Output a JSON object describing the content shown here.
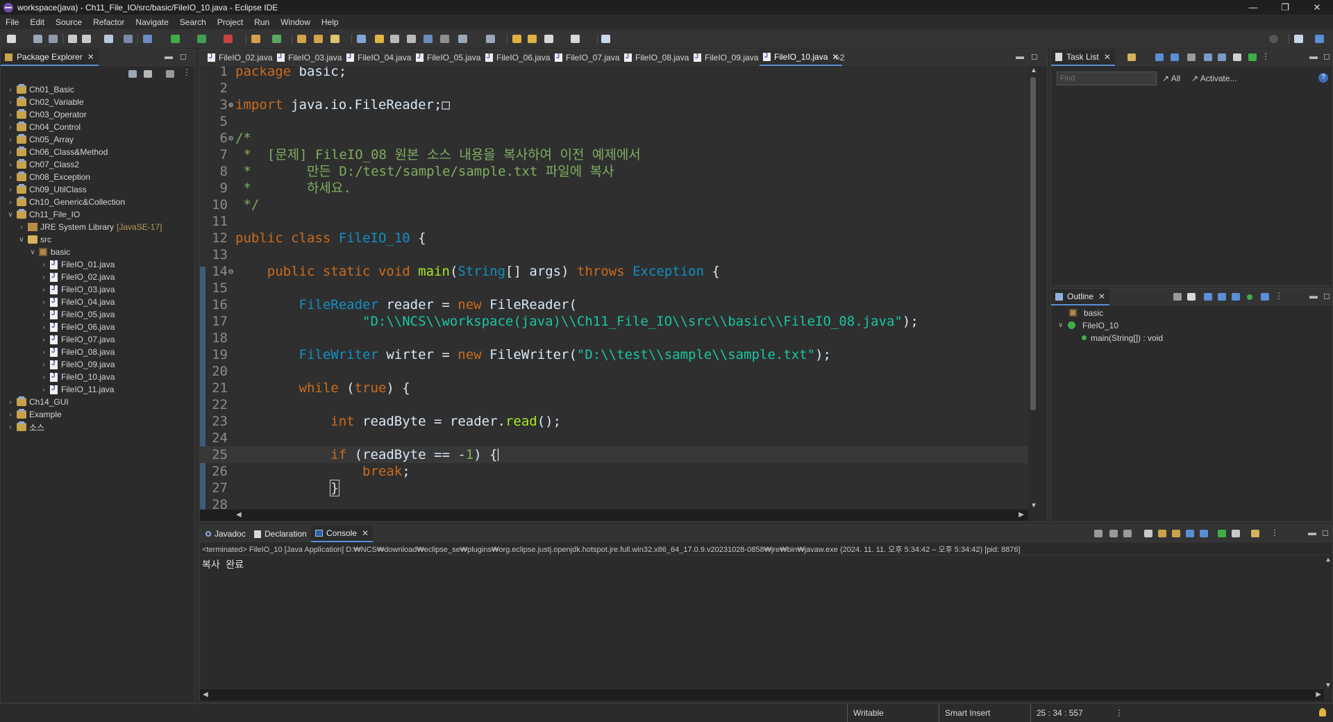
{
  "window": {
    "title": "workspace(java) - Ch11_File_IO/src/basic/FileIO_10.java - Eclipse IDE",
    "minimize": "—",
    "restore": "❐",
    "close": "✕"
  },
  "menu": [
    "File",
    "Edit",
    "Source",
    "Refactor",
    "Navigate",
    "Search",
    "Project",
    "Run",
    "Window",
    "Help"
  ],
  "package_explorer": {
    "title": "Package Explorer",
    "items": [
      {
        "label": "Ch01_Basic",
        "kind": "project",
        "level": 0,
        "expanded": false
      },
      {
        "label": "Ch02_Variable",
        "kind": "project",
        "level": 0,
        "expanded": false
      },
      {
        "label": "Ch03_Operator",
        "kind": "project",
        "level": 0,
        "expanded": false
      },
      {
        "label": "Ch04_Control",
        "kind": "project",
        "level": 0,
        "expanded": false
      },
      {
        "label": "Ch05_Array",
        "kind": "project",
        "level": 0,
        "expanded": false
      },
      {
        "label": "Ch06_Class&Method",
        "kind": "project",
        "level": 0,
        "expanded": false
      },
      {
        "label": "Ch07_Class2",
        "kind": "project",
        "level": 0,
        "expanded": false
      },
      {
        "label": "Ch08_Exception",
        "kind": "project",
        "level": 0,
        "expanded": false
      },
      {
        "label": "Ch09_UtilClass",
        "kind": "project",
        "level": 0,
        "expanded": false
      },
      {
        "label": "Ch10_Generic&Collection",
        "kind": "project",
        "level": 0,
        "expanded": false
      },
      {
        "label": "Ch11_File_IO",
        "kind": "project",
        "level": 0,
        "expanded": true
      },
      {
        "label": "JRE System Library",
        "suffix": "[JavaSE-17]",
        "kind": "library",
        "level": 1,
        "expanded": false
      },
      {
        "label": "src",
        "kind": "source",
        "level": 1,
        "expanded": true
      },
      {
        "label": "basic",
        "kind": "package",
        "level": 2,
        "expanded": true
      },
      {
        "label": "FileIO_01.java",
        "kind": "file",
        "level": 3,
        "expanded": false
      },
      {
        "label": "FileIO_02.java",
        "kind": "file",
        "level": 3,
        "expanded": false
      },
      {
        "label": "FileIO_03.java",
        "kind": "file",
        "level": 3,
        "expanded": false
      },
      {
        "label": "FileIO_04.java",
        "kind": "file",
        "level": 3,
        "expanded": false
      },
      {
        "label": "FileIO_05.java",
        "kind": "file",
        "level": 3,
        "expanded": false
      },
      {
        "label": "FileIO_06.java",
        "kind": "file",
        "level": 3,
        "expanded": false
      },
      {
        "label": "FileIO_07.java",
        "kind": "file",
        "level": 3,
        "expanded": false
      },
      {
        "label": "FileIO_08.java",
        "kind": "file",
        "level": 3,
        "expanded": false
      },
      {
        "label": "FileIO_09.java",
        "kind": "file",
        "level": 3,
        "expanded": false
      },
      {
        "label": "FileIO_10.java",
        "kind": "file",
        "level": 3,
        "expanded": false
      },
      {
        "label": "FileIO_11.java",
        "kind": "file",
        "level": 3,
        "expanded": false
      },
      {
        "label": "Ch14_GUI",
        "kind": "project",
        "level": 0,
        "expanded": false
      },
      {
        "label": "Example",
        "kind": "project",
        "level": 0,
        "expanded": false
      },
      {
        "label": "소스",
        "kind": "project",
        "level": 0,
        "expanded": false
      }
    ]
  },
  "editor": {
    "tabs": [
      "FileIO_02.java",
      "FileIO_03.java",
      "FileIO_04.java",
      "FileIO_05.java",
      "FileIO_06.java",
      "FileIO_07.java",
      "FileIO_08.java",
      "FileIO_09.java",
      "FileIO_10.java"
    ],
    "active_tab": "FileIO_10.java",
    "overflow": "»2",
    "lines": [
      {
        "n": "1",
        "fold": "",
        "current": false,
        "tokens": [
          [
            "kw",
            "package"
          ],
          [
            "plain",
            " basic;"
          ]
        ]
      },
      {
        "n": "2",
        "fold": "",
        "current": false,
        "tokens": []
      },
      {
        "n": "3",
        "fold": "⊕",
        "current": false,
        "tokens": [
          [
            "kw",
            "import"
          ],
          [
            "plain",
            " java.io.FileReader;"
          ],
          [
            "plain",
            "□"
          ]
        ]
      },
      {
        "n": "5",
        "fold": "",
        "current": false,
        "tokens": []
      },
      {
        "n": "6",
        "fold": "⊖",
        "current": false,
        "tokens": [
          [
            "cmt",
            "/*"
          ]
        ]
      },
      {
        "n": "7",
        "fold": "",
        "current": false,
        "tokens": [
          [
            "cmt",
            " *  [문제] FileIO_08 원본 소스 내용을 복사하여 이전 예제에서"
          ]
        ]
      },
      {
        "n": "8",
        "fold": "",
        "current": false,
        "tokens": [
          [
            "cmt",
            " *       만든 D:/test/sample/sample.txt 파일에 복사"
          ]
        ]
      },
      {
        "n": "9",
        "fold": "",
        "current": false,
        "tokens": [
          [
            "cmt",
            " *       하세요."
          ]
        ]
      },
      {
        "n": "10",
        "fold": "",
        "current": false,
        "tokens": [
          [
            "cmt",
            " */"
          ]
        ]
      },
      {
        "n": "11",
        "fold": "",
        "current": false,
        "tokens": []
      },
      {
        "n": "12",
        "fold": "",
        "current": false,
        "tokens": [
          [
            "kw",
            "public"
          ],
          [
            "plain",
            " "
          ],
          [
            "kw",
            "class"
          ],
          [
            "plain",
            " "
          ],
          [
            "cls",
            "FileIO_10"
          ],
          [
            "plain",
            " {"
          ]
        ]
      },
      {
        "n": "13",
        "fold": "",
        "current": false,
        "tokens": []
      },
      {
        "n": "14",
        "fold": "⊖",
        "current": false,
        "tokens": [
          [
            "plain",
            "    "
          ],
          [
            "kw",
            "public"
          ],
          [
            "plain",
            " "
          ],
          [
            "kw",
            "static"
          ],
          [
            "plain",
            " "
          ],
          [
            "kw",
            "void"
          ],
          [
            "plain",
            " "
          ],
          [
            "mth",
            "main"
          ],
          [
            "plain",
            "("
          ],
          [
            "cls",
            "String"
          ],
          [
            "plain",
            "[] "
          ],
          [
            "plain",
            "args) "
          ],
          [
            "kw",
            "throws"
          ],
          [
            "plain",
            " "
          ],
          [
            "cls",
            "Exception"
          ],
          [
            "plain",
            " {"
          ]
        ]
      },
      {
        "n": "15",
        "fold": "",
        "current": false,
        "tokens": []
      },
      {
        "n": "16",
        "fold": "",
        "current": false,
        "tokens": [
          [
            "plain",
            "        "
          ],
          [
            "cls",
            "FileReader"
          ],
          [
            "plain",
            " reader = "
          ],
          [
            "kw",
            "new"
          ],
          [
            "plain",
            " FileReader("
          ]
        ]
      },
      {
        "n": "17",
        "fold": "",
        "current": false,
        "tokens": [
          [
            "plain",
            "                "
          ],
          [
            "str",
            "\"D:\\\\NCS\\\\workspace(java)\\\\Ch11_File_IO\\\\src\\\\basic\\\\FileIO_08.java\""
          ],
          [
            "plain",
            ");"
          ]
        ]
      },
      {
        "n": "18",
        "fold": "",
        "current": false,
        "tokens": []
      },
      {
        "n": "19",
        "fold": "",
        "current": false,
        "tokens": [
          [
            "plain",
            "        "
          ],
          [
            "cls",
            "FileWriter"
          ],
          [
            "plain",
            " wirter = "
          ],
          [
            "kw",
            "new"
          ],
          [
            "plain",
            " FileWriter("
          ],
          [
            "str",
            "\"D:\\\\test\\\\sample\\\\sample.txt\""
          ],
          [
            "plain",
            ");"
          ]
        ]
      },
      {
        "n": "20",
        "fold": "",
        "current": false,
        "tokens": []
      },
      {
        "n": "21",
        "fold": "",
        "current": false,
        "tokens": [
          [
            "plain",
            "        "
          ],
          [
            "kw",
            "while"
          ],
          [
            "plain",
            " ("
          ],
          [
            "kw",
            "true"
          ],
          [
            "plain",
            ") {"
          ]
        ]
      },
      {
        "n": "22",
        "fold": "",
        "current": false,
        "tokens": []
      },
      {
        "n": "23",
        "fold": "",
        "current": false,
        "tokens": [
          [
            "plain",
            "            "
          ],
          [
            "kw",
            "int"
          ],
          [
            "plain",
            " readByte = reader."
          ],
          [
            "mth",
            "read"
          ],
          [
            "plain",
            "();"
          ]
        ]
      },
      {
        "n": "24",
        "fold": "",
        "current": false,
        "tokens": []
      },
      {
        "n": "25",
        "fold": "",
        "current": true,
        "tokens": [
          [
            "plain",
            "            "
          ],
          [
            "kw",
            "if"
          ],
          [
            "plain",
            " (readByte == -"
          ],
          [
            "num",
            "1"
          ],
          [
            "plain",
            ") {"
          ],
          [
            "caret",
            ""
          ]
        ]
      },
      {
        "n": "26",
        "fold": "",
        "current": false,
        "tokens": [
          [
            "plain",
            "                "
          ],
          [
            "kw",
            "break"
          ],
          [
            "plain",
            ";"
          ]
        ]
      },
      {
        "n": "27",
        "fold": "",
        "current": false,
        "tokens": [
          [
            "plain",
            "            "
          ],
          [
            "box",
            "}"
          ]
        ]
      },
      {
        "n": "28",
        "fold": "",
        "current": false,
        "tokens": []
      }
    ]
  },
  "task_list": {
    "title": "Task List",
    "find_placeholder": "Find",
    "all": "All",
    "activate": "Activate...",
    "help": "?"
  },
  "outline": {
    "title": "Outline",
    "items": [
      {
        "label": "basic"
      },
      {
        "label": "FileIO_10"
      },
      {
        "label": "main(String[]) : void"
      }
    ]
  },
  "bottom": {
    "tabs": [
      "Javadoc",
      "Declaration",
      "Console"
    ],
    "active": "Console",
    "launch": "<terminated> FileIO_10 [Java Application] D:₩NCS₩download₩eclipse_se₩plugins₩org.eclipse.justj.openjdk.hotspot.jre.full.win32.x86_64_17.0.9.v20231028-0858₩jre₩bin₩javaw.exe  (2024. 11. 11. 오후 5:34:42 – 오후 5:34:42) [pid: 8876]",
    "output": "복사 완료"
  },
  "status": {
    "writable": "Writable",
    "insert_mode": "Smart Insert",
    "position": "25 : 34 : 557"
  }
}
